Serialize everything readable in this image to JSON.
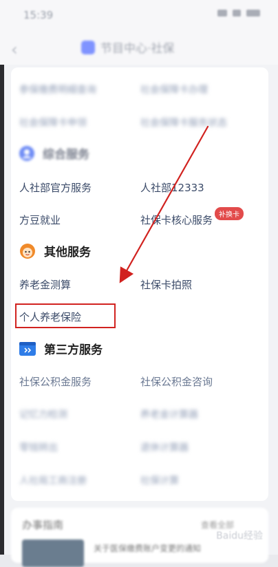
{
  "status_bar": {
    "time": "15:39"
  },
  "nav": {
    "title": "节目中心·社保"
  },
  "blurred_top": [
    [
      "参保缴费明细查询",
      "社会保障卡办理"
    ],
    [
      "社会保障卡申领",
      "社会保障卡服务状态"
    ]
  ],
  "sections": [
    {
      "title": "综合服务",
      "items": [
        "人社部官方服务",
        "人社部12333",
        "方豆就业",
        "社保卡核心服务"
      ],
      "badge": "补换卡"
    },
    {
      "title": "其他服务",
      "items": [
        "养老金测算",
        "社保卡拍照",
        "个人养老保险"
      ]
    },
    {
      "title": "第三方服务",
      "items": [
        "社保公积金服务",
        "社保公积金咨询"
      ]
    }
  ],
  "blurred_bottom": [
    [
      "记忆力检测",
      "养老金计算器"
    ],
    [
      "零钱转出",
      "退休计算器"
    ],
    [
      "人社局工商注册",
      "社保计算"
    ]
  ],
  "bottom_card": {
    "title": "办事指南",
    "more": "查看全部",
    "item": "关于医保缴费账户变更的通知"
  },
  "watermark": "Baidu经验",
  "colors": {
    "highlight_box": "#d1221f",
    "arrow": "#d1221f",
    "badge": "#e24b4b",
    "link_text": "#3a4a68"
  },
  "icons": [
    "back-icon",
    "mini-program-icon",
    "user-service-icon",
    "mascot-icon",
    "third-party-card-icon"
  ]
}
